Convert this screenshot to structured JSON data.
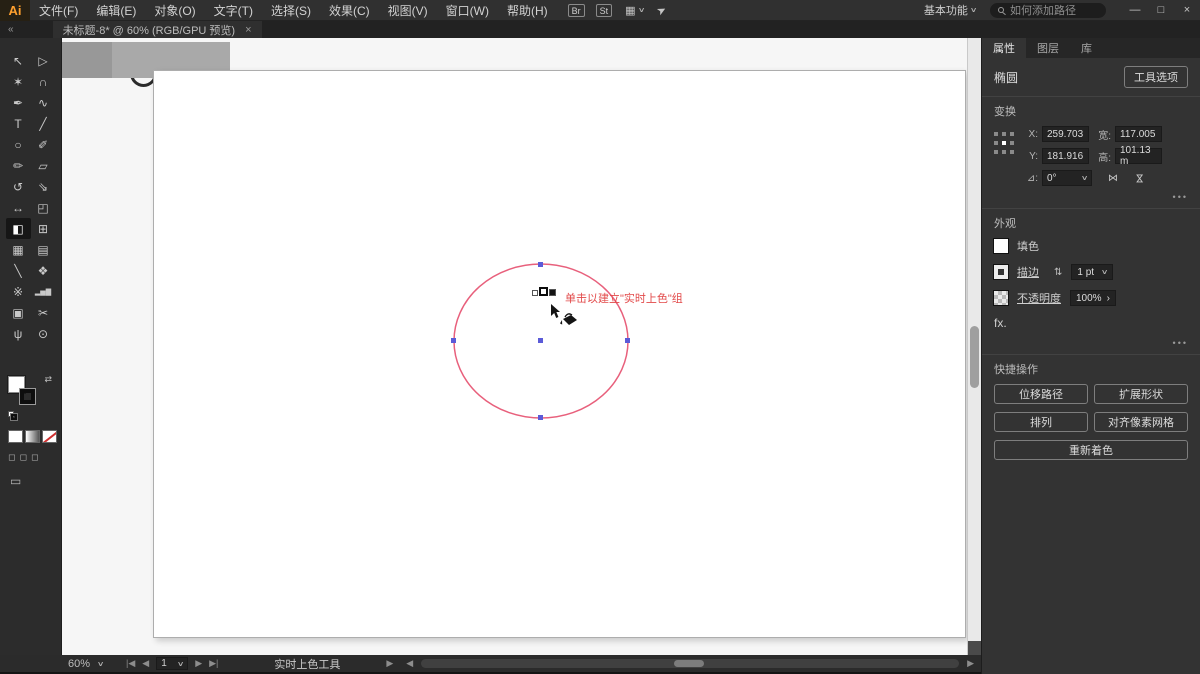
{
  "colors": {
    "ellipse_stroke": "#e8607c",
    "anchor_point": "#5b5bd8",
    "tooltip_text": "#e24a4a",
    "logo_orange": "#ffa02e",
    "panel_background": "#333333",
    "fill_color": "#ffffff"
  },
  "icons": {
    "collapse_panel": "«",
    "caret_down": "∨",
    "chevron_right": "›",
    "close": "×",
    "minimize": "—",
    "maximize": "□",
    "grid_view": "▦",
    "share": "➤",
    "swap_colors": "⇄",
    "stepper": "⇅",
    "more_options": "•••",
    "flip_horizontal": "⋈",
    "flip_vertical": "⋈",
    "constrain_link": "∞",
    "angle_label": "⊿:",
    "draw_mode": "◻",
    "screen_mode": "▭",
    "nav_first": "|◀",
    "nav_prev": "◀",
    "nav_next": "▶",
    "nav_last": "▶|",
    "scroll_left": "◀",
    "scroll_right": "▶"
  },
  "menu": {
    "logo": "Ai",
    "items": [
      "文件(F)",
      "编辑(E)",
      "对象(O)",
      "文字(T)",
      "选择(S)",
      "效果(C)",
      "视图(V)",
      "窗口(W)",
      "帮助(H)"
    ],
    "bridge": "Br",
    "stock": "St",
    "workspace": "基本功能",
    "search_placeholder": "如何添加路径"
  },
  "document_tab": {
    "title": "未标题-8* @ 60% (RGB/GPU 预览)"
  },
  "toolbar": {
    "tools": [
      {
        "name": "selection-tool",
        "glyph": "↖"
      },
      {
        "name": "direct-selection-tool",
        "glyph": "▷"
      },
      {
        "name": "magic-wand-tool",
        "glyph": "✶"
      },
      {
        "name": "lasso-tool",
        "glyph": "∩"
      },
      {
        "name": "pen-tool",
        "glyph": "✒"
      },
      {
        "name": "curvature-tool",
        "glyph": "∿"
      },
      {
        "name": "type-tool",
        "glyph": "T"
      },
      {
        "name": "line-segment-tool",
        "glyph": "╱"
      },
      {
        "name": "ellipse-tool",
        "glyph": "○"
      },
      {
        "name": "paintbrush-tool",
        "glyph": "✐"
      },
      {
        "name": "shaper-tool",
        "glyph": "✏"
      },
      {
        "name": "eraser-tool",
        "glyph": "▱"
      },
      {
        "name": "rotate-tool",
        "glyph": "↺"
      },
      {
        "name": "scale-tool",
        "glyph": "⇘"
      },
      {
        "name": "width-tool",
        "glyph": "↔"
      },
      {
        "name": "free-transform-tool",
        "glyph": "◰"
      },
      {
        "name": "live-paint-bucket-tool",
        "glyph": "◧"
      },
      {
        "name": "perspective-grid-tool",
        "glyph": "⊞"
      },
      {
        "name": "mesh-tool",
        "glyph": "▦"
      },
      {
        "name": "gradient-tool",
        "glyph": "▤"
      },
      {
        "name": "eyedropper-tool",
        "glyph": "╲"
      },
      {
        "name": "blend-tool",
        "glyph": "❖"
      },
      {
        "name": "symbol-sprayer-tool",
        "glyph": "※"
      },
      {
        "name": "column-graph-tool",
        "glyph": "▂▅▇"
      },
      {
        "name": "artboard-tool",
        "glyph": "▣"
      },
      {
        "name": "slice-tool",
        "glyph": "✂"
      },
      {
        "name": "hand-tool",
        "glyph": "ψ"
      },
      {
        "name": "zoom-tool",
        "glyph": "⊙"
      }
    ]
  },
  "canvas": {
    "tooltip": "单击以建立\"实时上色\"组"
  },
  "panel": {
    "tabs": [
      "属性",
      "图层",
      "库"
    ],
    "object_type": "椭圆",
    "tool_options_label": "工具选项",
    "transform": {
      "title": "变换",
      "x_label": "X:",
      "x_value": "259.703",
      "y_label": "Y:",
      "y_value": "181.916",
      "width_label": "宽:",
      "width_value": "117.005",
      "height_label": "高:",
      "height_value": "101.13 m",
      "angle_value": "0°"
    },
    "appearance": {
      "title": "外观",
      "fill_label": "填色",
      "stroke_label": "描边",
      "stroke_weight": "1 pt",
      "opacity_label": "不透明度",
      "opacity_value": "100%",
      "fx_label": "fx."
    },
    "quick_actions": {
      "title": "快捷操作",
      "buttons": [
        "位移路径",
        "扩展形状",
        "排列",
        "对齐像素网格",
        "重新着色"
      ]
    }
  },
  "statusbar": {
    "zoom": "60%",
    "artboard_number": "1",
    "tool_status": "实时上色工具"
  }
}
